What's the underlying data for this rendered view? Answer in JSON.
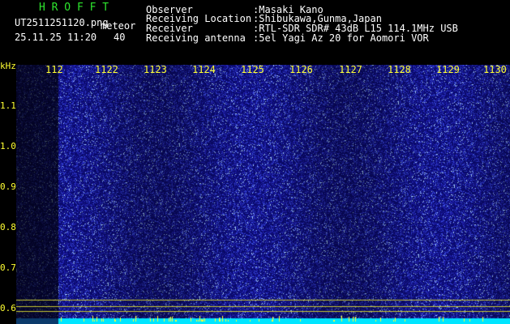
{
  "header": {
    "title": "H R O F F T",
    "filename": "UT2511251120.png",
    "mode": "meteor",
    "datetime": "25.11.25 11:20",
    "count": "40",
    "observer_label": "Observer",
    "observer_value": ":Masaki Kano",
    "location_label": "Receiving Location",
    "location_value": ":Shibukawa,Gunma,Japan",
    "receiver_label": "Receiver",
    "receiver_value": ":RTL-SDR SDR# 43dB L15 114.1MHz USB",
    "antenna_label": "Receiving antenna",
    "antenna_value": ":5el Yagi Az 20 for Aomori VOR"
  },
  "axes": {
    "y_unit": "kHz",
    "y_ticks": [
      "1.1",
      "1.0",
      "0.9",
      "0.8",
      "0.7",
      "0.6"
    ],
    "x_ticks": [
      "112",
      "1122",
      "1123",
      "1124",
      "1125",
      "1126",
      "1127",
      "1128",
      "1129",
      "1130"
    ]
  },
  "colors": {
    "background": "#000000",
    "header_text": "#ffffff",
    "title_text": "#2ee62e",
    "axis_text": "#ffff33",
    "noise_base": "#1a1a9e",
    "baseline": "#00e5ff"
  }
}
